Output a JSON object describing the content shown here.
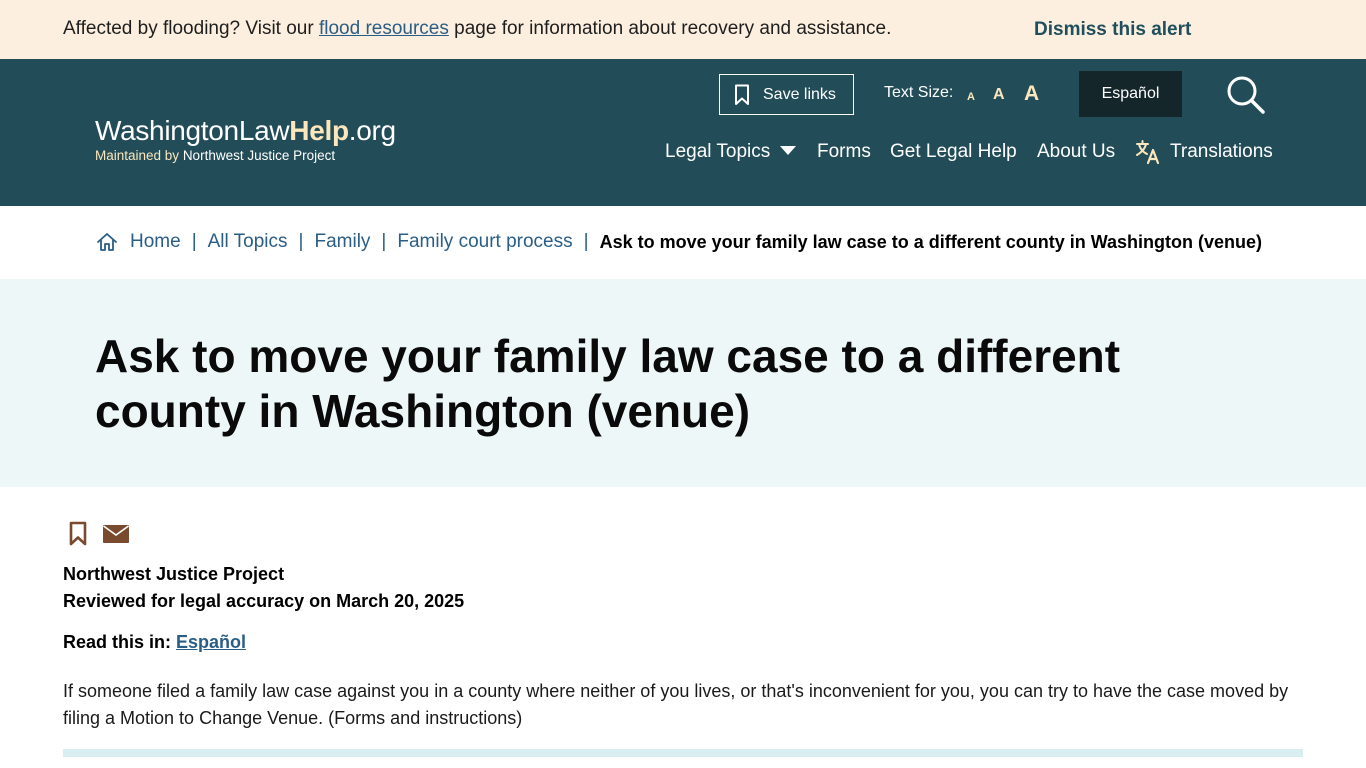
{
  "alert": {
    "text_before": "Affected by flooding? Visit our ",
    "link": "flood resources",
    "text_after": " page for information about recovery and assistance.",
    "dismiss": "Dismiss this alert"
  },
  "header": {
    "logo_part1": "WashingtonLaw",
    "logo_part2": "Help",
    "logo_part3": ".org",
    "logo_sub_prefix": "Maintained by ",
    "logo_sub_org": "Northwest Justice Project",
    "save_links": "Save links",
    "text_size_label": "Text Size:",
    "text_size_small": "A",
    "text_size_medium": "A",
    "text_size_large": "A",
    "language_button": "Español",
    "nav": {
      "legal_topics": "Legal Topics",
      "forms": "Forms",
      "get_legal_help": "Get Legal Help",
      "about_us": "About Us",
      "translations": "Translations"
    }
  },
  "breadcrumb": {
    "home": "Home",
    "all_topics": "All Topics",
    "family": "Family",
    "family_court": "Family court process",
    "current": "Ask to move your family law case to a different county in Washington (venue)",
    "separator": "|"
  },
  "page": {
    "title": "Ask to move your family law case to a different county in Washington (venue)",
    "author": "Northwest Justice Project",
    "reviewed": "Reviewed for legal accuracy on March 20, 2025",
    "read_in_label": "Read this in: ",
    "read_in_link": "Español",
    "intro": "If someone filed a family law case against you in a county where neither of you lives, or that's inconvenient for you, you can try to have the case moved by filing a Motion to Change Venue. (Forms and instructions)"
  },
  "colors": {
    "header_bg": "#224d58",
    "alert_bg": "#fcefdf",
    "title_band_bg": "#eef7f8",
    "link": "#2a5e86",
    "accent": "#fbe6bd",
    "icon_brown": "#7a4a2e"
  },
  "icons": {
    "save": "bookmark-icon",
    "search": "search-icon",
    "translate": "translate-icon",
    "home": "home-icon",
    "email": "envelope-icon"
  }
}
